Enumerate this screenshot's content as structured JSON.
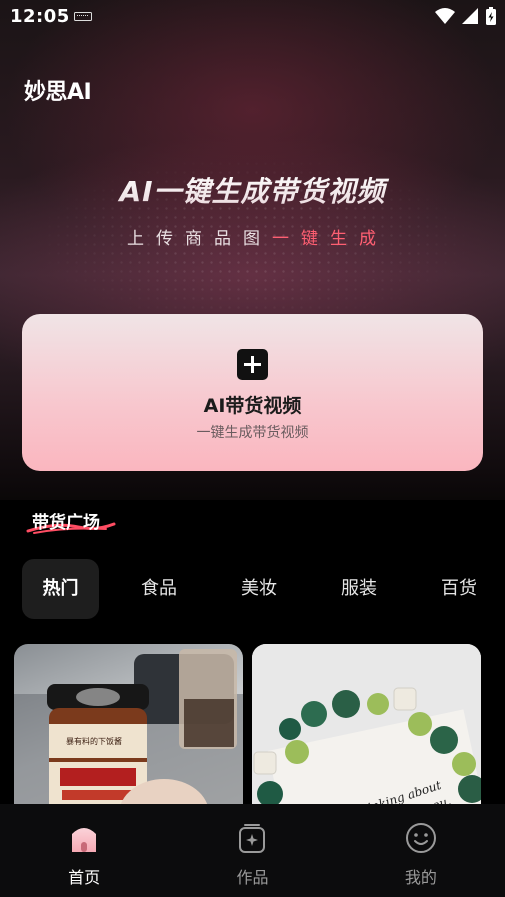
{
  "status_bar": {
    "time": "12:05"
  },
  "brand": {
    "logo_text": "妙思AI"
  },
  "hero": {
    "title": "AI一键生成带货视频",
    "subtitle_part1": "上传商品图",
    "subtitle_part2": "一键生成"
  },
  "create_card": {
    "title": "AI带货视频",
    "subtitle": "一键生成带货视频"
  },
  "plaza": {
    "title": "带货广场",
    "tabs": [
      {
        "label": "热门",
        "active": true
      },
      {
        "label": "食品",
        "active": false
      },
      {
        "label": "美妆",
        "active": false
      },
      {
        "label": "服装",
        "active": false
      },
      {
        "label": "百货",
        "active": false
      }
    ],
    "tiles": [
      {
        "caption": "暴有料的下饭酱"
      },
      {
        "caption": "flowers thinking about you, I mean, I love you, studio and love"
      }
    ]
  },
  "bottom_nav": [
    {
      "label": "首页",
      "icon": "home-icon",
      "active": true
    },
    {
      "label": "作品",
      "icon": "works-icon",
      "active": false
    },
    {
      "label": "我的",
      "icon": "profile-icon",
      "active": false
    }
  ],
  "colors": {
    "accent": "#ff5f72",
    "card_pink": "#f8c6cd",
    "background": "#000000"
  }
}
